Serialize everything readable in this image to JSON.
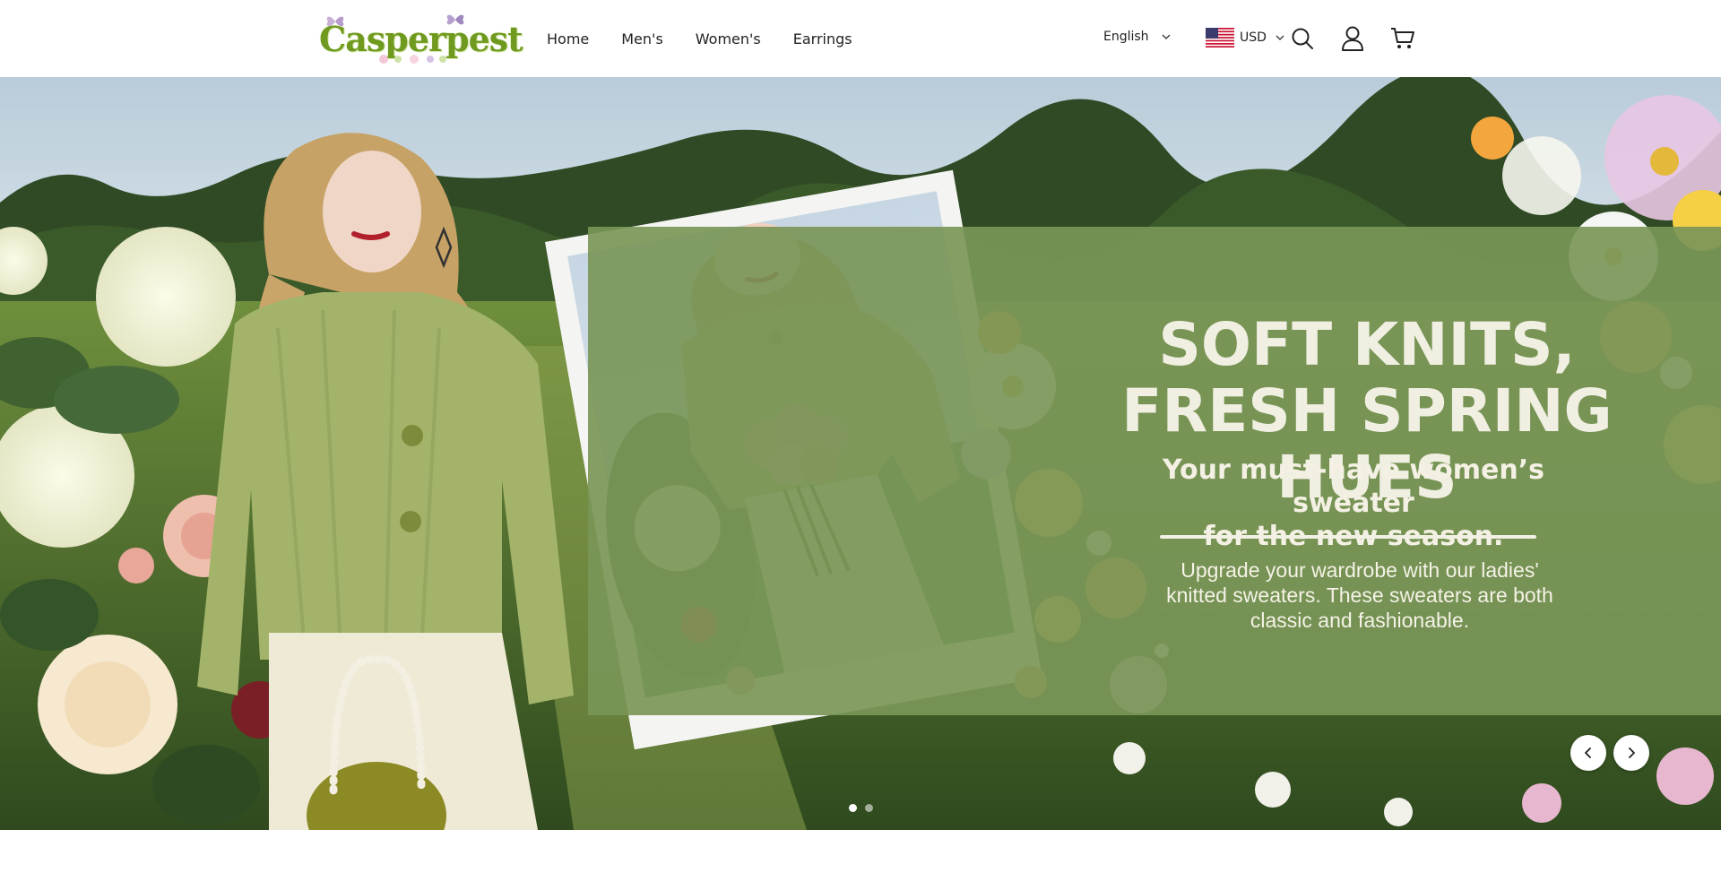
{
  "brand": {
    "name": "Casperpest"
  },
  "nav": {
    "items": [
      {
        "label": "Home"
      },
      {
        "label": "Men's"
      },
      {
        "label": "Women's"
      },
      {
        "label": "Earrings"
      }
    ]
  },
  "header": {
    "language": "English",
    "currency": "USD",
    "icons": [
      "search-icon",
      "account-icon",
      "cart-icon"
    ]
  },
  "hero": {
    "headline_line1": "SOFT KNITS,",
    "headline_line2": "FRESH SPRING HUES",
    "subhead_line1": "Your must-have women’s sweater",
    "subhead_line2": "for the new season.",
    "body_line1": "Upgrade your wardrobe with our ladies'",
    "body_line2": "knitted sweaters. These sweaters are both",
    "body_line3": "classic and fashionable.",
    "slides_total": 2,
    "slide_active": 1
  },
  "colors": {
    "panel": "#7a9658",
    "headline": "#f0efe2",
    "logo": "#6f9a1f",
    "sweater": "#a3b46a"
  }
}
